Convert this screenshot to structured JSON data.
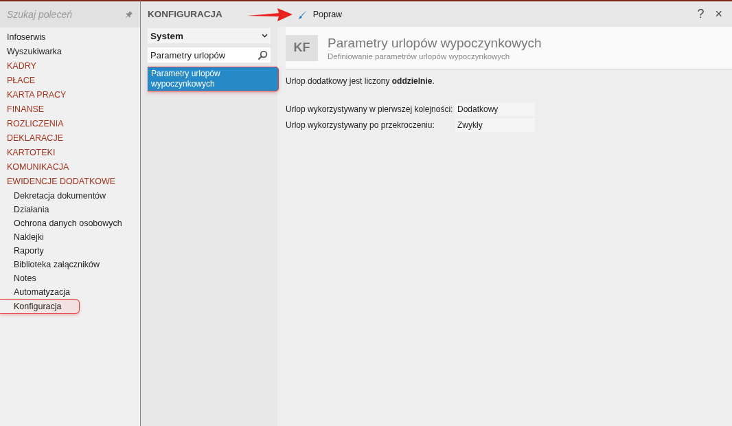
{
  "sidebar": {
    "search": {
      "placeholder": "Szukaj poleceń"
    },
    "items": [
      {
        "label": "Infoserwis",
        "kind": "plain",
        "selected": false
      },
      {
        "label": "Wyszukiwarka",
        "kind": "plain",
        "selected": false
      },
      {
        "label": "KADRY",
        "kind": "section",
        "selected": false
      },
      {
        "label": "PŁACE",
        "kind": "section",
        "selected": false
      },
      {
        "label": "KARTA PRACY",
        "kind": "section",
        "selected": false
      },
      {
        "label": "FINANSE",
        "kind": "section",
        "selected": false
      },
      {
        "label": "ROZLICZENIA",
        "kind": "section",
        "selected": false
      },
      {
        "label": "DEKLARACJE",
        "kind": "section",
        "selected": false
      },
      {
        "label": "KARTOTEKI",
        "kind": "section",
        "selected": false
      },
      {
        "label": "KOMUNIKACJA",
        "kind": "section",
        "selected": false
      },
      {
        "label": "EWIDENCJE DODATKOWE",
        "kind": "section",
        "selected": false
      },
      {
        "label": "Dekretacja dokumentów",
        "kind": "sub",
        "selected": false
      },
      {
        "label": "Działania",
        "kind": "sub",
        "selected": false
      },
      {
        "label": "Ochrona danych osobowych",
        "kind": "sub",
        "selected": false
      },
      {
        "label": "Naklejki",
        "kind": "sub",
        "selected": false
      },
      {
        "label": "Raporty",
        "kind": "sub",
        "selected": false
      },
      {
        "label": "Biblioteka załączników",
        "kind": "sub",
        "selected": false
      },
      {
        "label": "Notes",
        "kind": "sub",
        "selected": false
      },
      {
        "label": "Automatyzacja",
        "kind": "sub",
        "selected": false
      },
      {
        "label": "Konfiguracja",
        "kind": "sub",
        "selected": true
      }
    ]
  },
  "toolbar": {
    "title": "KONFIGURACJA",
    "edit_button": "Popraw",
    "help": "?",
    "close": "×"
  },
  "config_list": {
    "dropdown": "System",
    "filter": "Parametry urlopów",
    "items": [
      {
        "label": "Parametry urlopów wypoczynkowych",
        "selected": true
      }
    ]
  },
  "detail": {
    "badge": "KF",
    "title": "Parametry urlopów wypoczynkowych",
    "subtitle": "Definiowanie parametrów urlopów wypoczynkowych",
    "note": "Urlop dodatkowy jest liczony **oddzielnie**.",
    "fields": [
      {
        "label": "Urlop wykorzystywany w pierwszej kolejności:",
        "value": "Dodatkowy"
      },
      {
        "label": "Urlop wykorzystywany po przekroczeniu:",
        "value": "Zwykły"
      }
    ]
  }
}
